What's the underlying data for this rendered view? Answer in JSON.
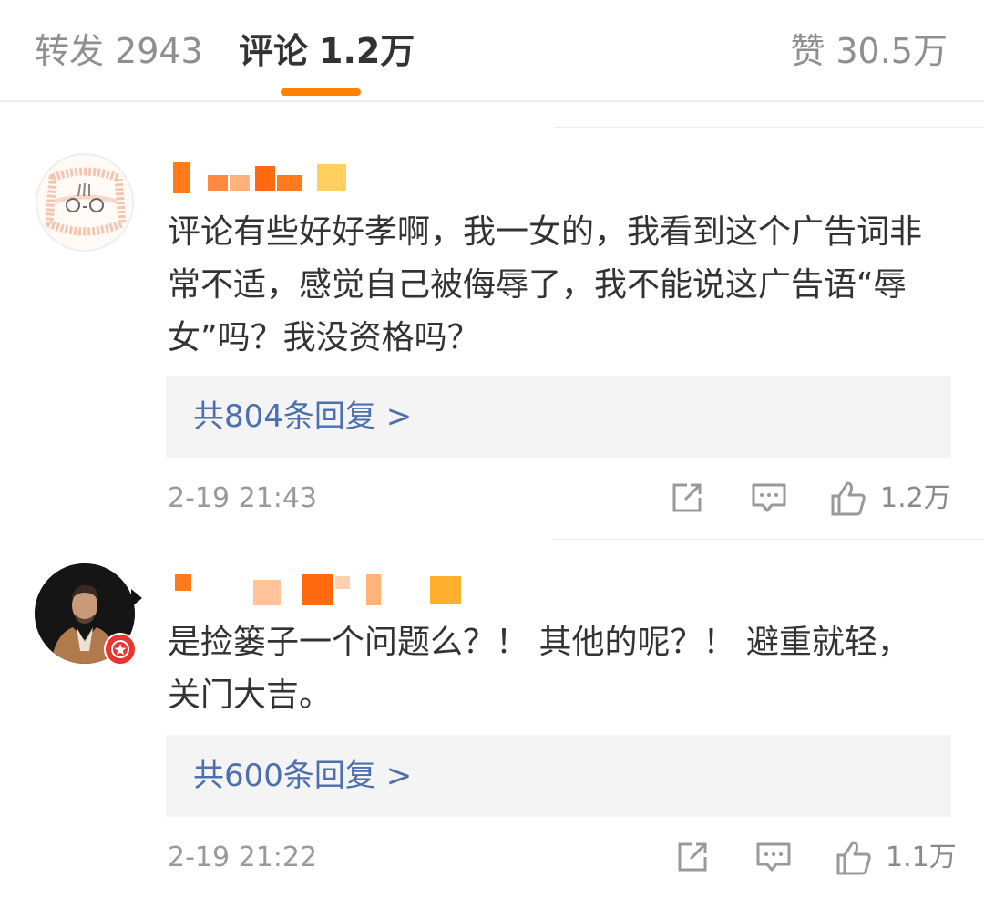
{
  "tabs": {
    "repost": {
      "label": "转发",
      "count": "2943"
    },
    "comments": {
      "label": "评论",
      "count": "1.2万"
    },
    "likes": {
      "label": "赞",
      "count": "30.5万"
    }
  },
  "comments": [
    {
      "text": "评论有些好好孝啊，我一女的，我看到这个广告词非常不适，感觉自己被侮辱了，我不能说这广告语“辱女”吗？我没资格吗？",
      "replies": "共804条回复 >",
      "time": "2-19 21:43",
      "likes": "1.2万",
      "avatar_icon": "cartoon-face-avatar"
    },
    {
      "text": "是捡篓子一个问题么？！ 其他的呢？！ 避重就轻，关门大吉。",
      "replies": "共600条回复 >",
      "time": "2-19 21:22",
      "likes": "1.1万",
      "avatar_icon": "man-photo-avatar"
    }
  ],
  "icons": {
    "share": "share-icon",
    "comment": "comment-icon",
    "like": "thumbs-up-icon"
  },
  "colors": {
    "accent": "#ff8200",
    "link": "#4c6fb0",
    "muted": "#9a9a9a"
  }
}
